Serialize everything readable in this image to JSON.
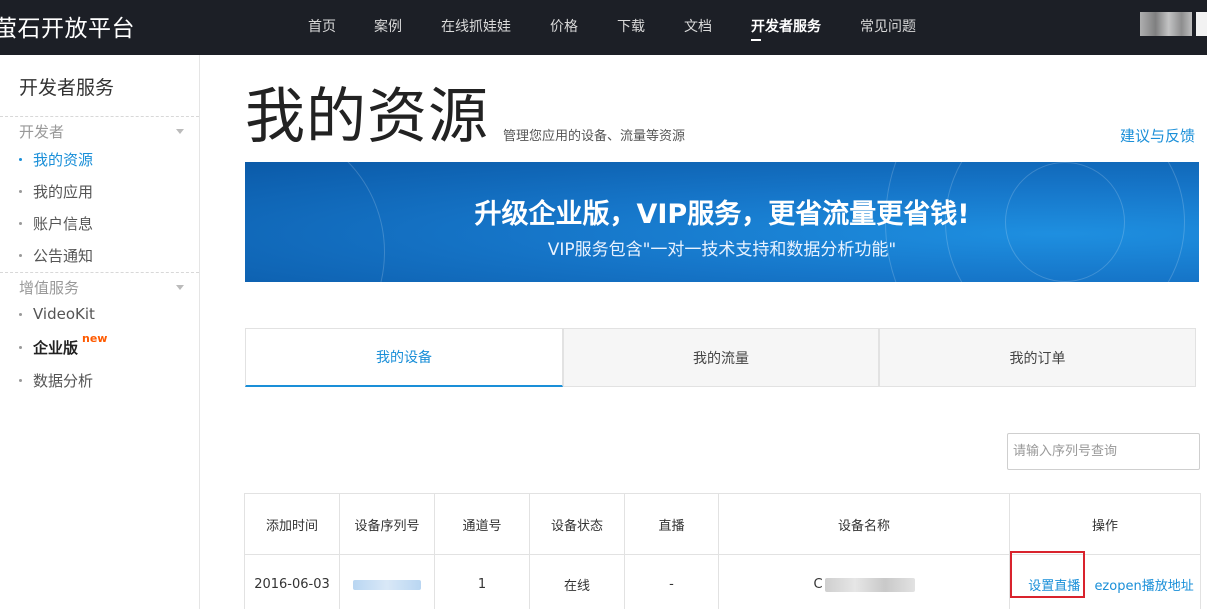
{
  "header": {
    "brand": "萤石开放平台",
    "nav": [
      {
        "label": "首页"
      },
      {
        "label": "案例"
      },
      {
        "label": "在线抓娃娃"
      },
      {
        "label": "价格"
      },
      {
        "label": "下载"
      },
      {
        "label": "文档"
      },
      {
        "label": "开发者服务",
        "active": true
      },
      {
        "label": "常见问题"
      }
    ]
  },
  "sidebar": {
    "title": "开发者服务",
    "groups": [
      {
        "label": "开发者",
        "items": [
          {
            "label": "我的资源",
            "active": true
          },
          {
            "label": "我的应用"
          },
          {
            "label": "账户信息"
          },
          {
            "label": "公告通知"
          }
        ]
      },
      {
        "label": "增值服务",
        "items": [
          {
            "label": "VideoKit"
          },
          {
            "label": "企业版",
            "badge": "new"
          },
          {
            "label": "数据分析"
          }
        ]
      }
    ]
  },
  "main": {
    "title": "我的资源",
    "subtitle": "管理您应用的设备、流量等资源",
    "feedback_link": "建议与反馈",
    "banner": {
      "title": "升级企业版，VIP服务，更省流量更省钱!",
      "subtitle": "VIP服务包含\"一对一技术支持和数据分析功能\""
    },
    "tabs": [
      {
        "label": "我的设备",
        "active": true
      },
      {
        "label": "我的流量"
      },
      {
        "label": "我的订单"
      }
    ],
    "search": {
      "placeholder": "请输入序列号查询",
      "value": ""
    },
    "table": {
      "columns": [
        "添加时间",
        "设备序列号",
        "通道号",
        "设备状态",
        "直播",
        "设备名称",
        "操作"
      ],
      "rows": [
        {
          "added_time": "2016-06-03",
          "serial": "",
          "channel": "1",
          "status": "在线",
          "live": "-",
          "name_prefix": "C",
          "action_set_live": "设置直播",
          "action_ezopen": "ezopen播放地址"
        }
      ]
    }
  },
  "colors": {
    "topbar": "#1c1f26",
    "accent": "#1a8fd8",
    "online": "#3a9e2f",
    "badge_new": "#ff5a00",
    "highlight_box": "#d9232d"
  }
}
